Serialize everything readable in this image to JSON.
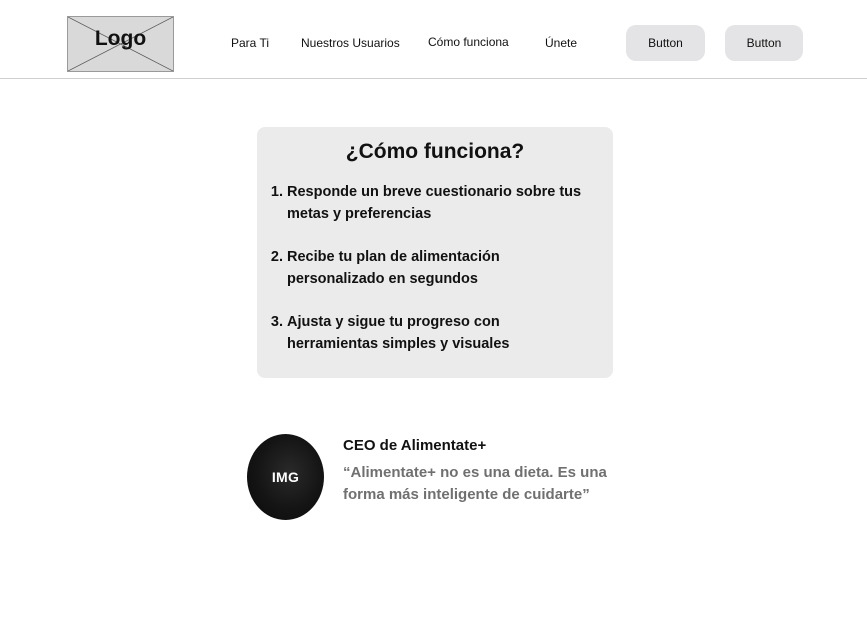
{
  "header": {
    "logo_text": "Logo",
    "nav": [
      {
        "label": "Para Ti"
      },
      {
        "label": "Nuestros Usuarios"
      },
      {
        "label": "Cómo funciona"
      },
      {
        "label": "Únete"
      }
    ],
    "buttons": [
      {
        "label": "Button"
      },
      {
        "label": "Button"
      }
    ]
  },
  "how_it_works": {
    "title": "¿Cómo funciona?",
    "steps": [
      {
        "number": "1.",
        "text": "Responde un breve cuestionario sobre tus metas y preferencias"
      },
      {
        "number": "2.",
        "text": "Recibe tu plan de alimentación personalizado en segundos"
      },
      {
        "number": "3.",
        "text": "Ajusta y sigue tu progreso con herramientas simples y visuales"
      }
    ]
  },
  "testimonial": {
    "avatar_label": "IMG",
    "name": "CEO de Alimentate+",
    "quote": "“Alimentate+ no es una dieta. Es una forma más inteligente de cuidarte”"
  },
  "colors": {
    "card_bg": "#ebebeb",
    "button_bg": "#e4e4e6",
    "quote_text": "#707070",
    "logo_bg": "#d9d9d9"
  }
}
